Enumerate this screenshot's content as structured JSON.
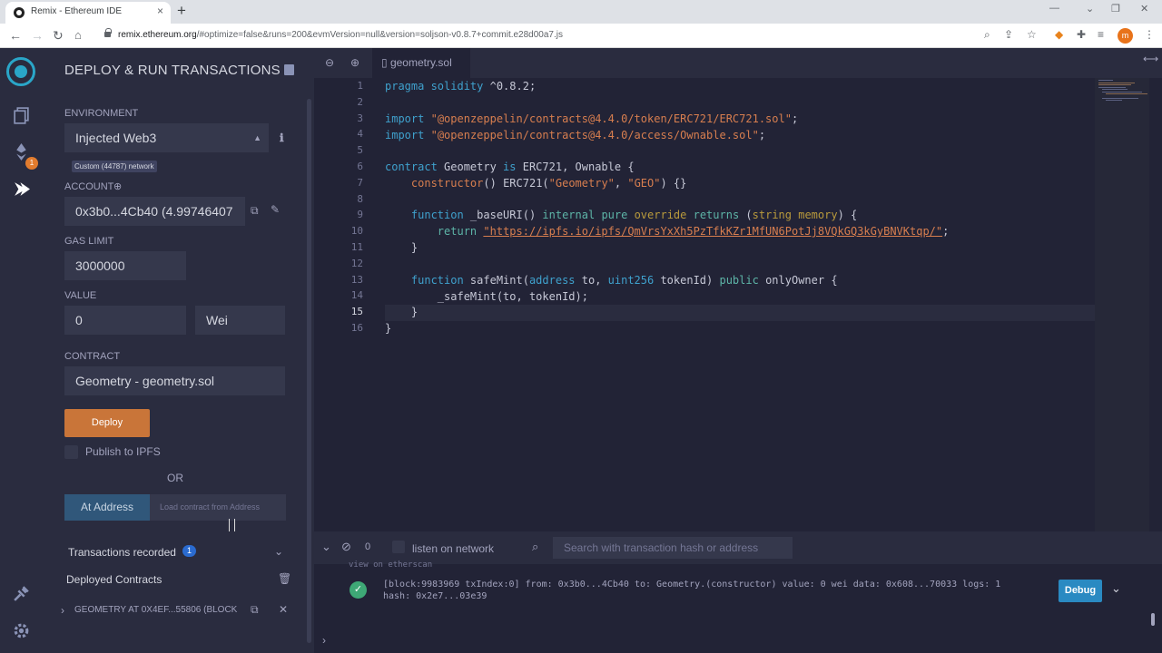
{
  "browser": {
    "tab_title": "Remix - Ethereum IDE",
    "url_host": "remix.ethereum.org",
    "url_rest": "/#optimize=false&runs=200&evmVersion=null&version=soljson-v0.8.7+commit.e28d00a7.js",
    "profile_initial": "m"
  },
  "icon_panel": {
    "compiler_badge": "1"
  },
  "side_panel": {
    "title": "DEPLOY & RUN TRANSACTIONS",
    "environment_label": "ENVIRONMENT",
    "environment_value": "Injected Web3",
    "network_badge": "Custom (44787) network",
    "account_label": "ACCOUNT",
    "account_value": "0x3b0...4Cb40 (4.99746407",
    "gas_limit_label": "GAS LIMIT",
    "gas_limit_value": "3000000",
    "value_label": "VALUE",
    "value_amount": "0",
    "value_unit": "Wei",
    "contract_label": "CONTRACT",
    "contract_value": "Geometry - geometry.sol",
    "deploy_label": "Deploy",
    "publish_ipfs_label": "Publish to IPFS",
    "or_label": "OR",
    "at_address_label": "At Address",
    "at_address_placeholder": "Load contract from Address",
    "transactions_recorded_label": "Transactions recorded",
    "transactions_recorded_count": "1",
    "deployed_contracts_label": "Deployed Contracts",
    "deployed_instance_label": "GEOMETRY AT 0X4EF...55806 (BLOCK"
  },
  "editor": {
    "file_tab": "geometry.sol",
    "active_line": 15,
    "line_numbers": [
      "1",
      "2",
      "3",
      "4",
      "5",
      "6",
      "7",
      "8",
      "9",
      "10",
      "11",
      "12",
      "13",
      "14",
      "15",
      "16"
    ]
  },
  "terminal": {
    "pending_count": "0",
    "listen_label": "listen on network",
    "search_placeholder": "Search with transaction hash or address",
    "clipped_text": "view on etherscan",
    "tx_line1": "[block:9983969 txIndex:0] from: 0x3b0...4Cb40 to: Geometry.(constructor) value: 0 wei data: 0x608...70033 logs: 1",
    "tx_line2": "hash: 0x2e7...03e39",
    "debug_label": "Debug"
  }
}
